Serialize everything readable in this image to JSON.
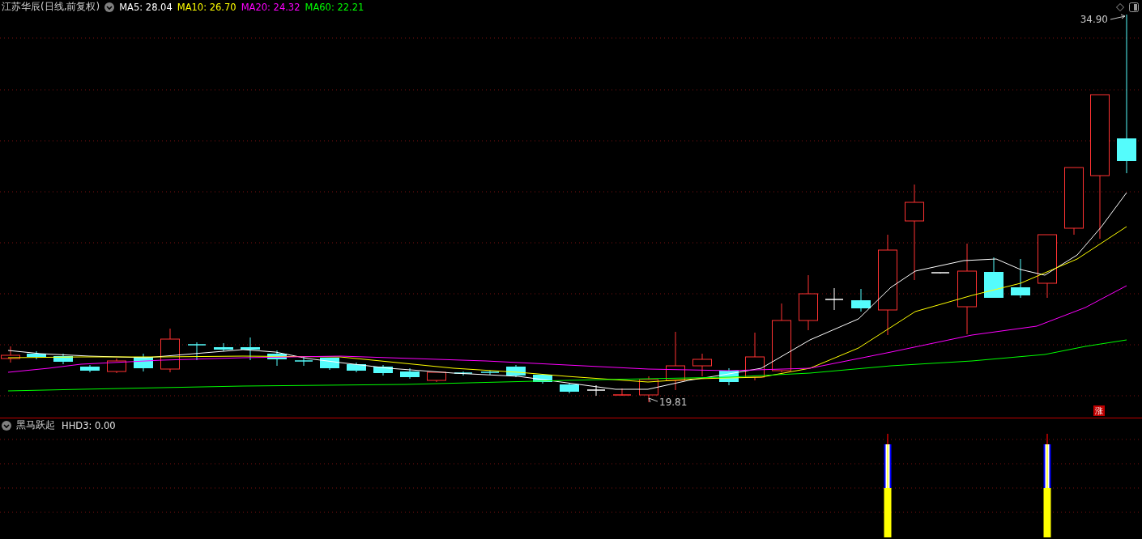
{
  "title": "江苏华辰(日线,前复权)",
  "ma_legend": [
    {
      "label": "MA5:",
      "value": "28.04",
      "color": "#ffffff"
    },
    {
      "label": "MA10:",
      "value": "26.70",
      "color": "#ffff00"
    },
    {
      "label": "MA20:",
      "value": "24.32",
      "color": "#ff00ff"
    },
    {
      "label": "MA60:",
      "value": "22.21",
      "color": "#00ff00"
    }
  ],
  "price_chart": {
    "high_label": "34.90",
    "low_label": "19.81",
    "badge": "涨"
  },
  "indicator": {
    "name": "黑马跃起",
    "legend": [
      {
        "label": "HHD3:",
        "value": "0.00"
      }
    ]
  }
}
